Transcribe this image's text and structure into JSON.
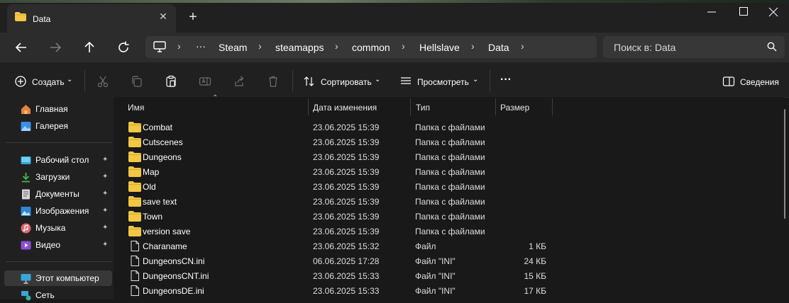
{
  "window": {
    "tab_title": "Data",
    "new_tab_glyph": "+",
    "close_tab_glyph": "✕"
  },
  "address": {
    "breadcrumbs": [
      "Steam",
      "steamapps",
      "common",
      "Hellslave",
      "Data"
    ],
    "more_glyph": "···",
    "search_placeholder": "Поиск в: Data"
  },
  "toolbar": {
    "create_label": "Создать",
    "sort_label": "Сортировать",
    "view_label": "Просмотреть",
    "more_glyph": "···",
    "details_label": "Сведения"
  },
  "sidebar": {
    "top_items": [
      {
        "label": "Главная",
        "icon": "home-icon"
      },
      {
        "label": "Галерея",
        "icon": "gallery-icon"
      }
    ],
    "pinned_items": [
      {
        "label": "Рабочий стол",
        "icon": "desktop-icon"
      },
      {
        "label": "Загрузки",
        "icon": "downloads-icon"
      },
      {
        "label": "Документы",
        "icon": "documents-icon"
      },
      {
        "label": "Изображения",
        "icon": "pictures-icon"
      },
      {
        "label": "Музыка",
        "icon": "music-icon"
      },
      {
        "label": "Видео",
        "icon": "videos-icon"
      }
    ],
    "bottom_items": [
      {
        "label": "Этот компьютер",
        "icon": "this-pc-icon"
      },
      {
        "label": "Сеть",
        "icon": "network-icon"
      }
    ]
  },
  "columns": {
    "name": "Имя",
    "date": "Дата изменения",
    "type": "Тип",
    "size": "Размер"
  },
  "files": [
    {
      "name": "Combat",
      "date": "23.06.2025 15:39",
      "type": "Папка с файлами",
      "size": "",
      "kind": "folder"
    },
    {
      "name": "Cutscenes",
      "date": "23.06.2025 15:39",
      "type": "Папка с файлами",
      "size": "",
      "kind": "folder"
    },
    {
      "name": "Dungeons",
      "date": "23.06.2025 15:39",
      "type": "Папка с файлами",
      "size": "",
      "kind": "folder"
    },
    {
      "name": "Map",
      "date": "23.06.2025 15:39",
      "type": "Папка с файлами",
      "size": "",
      "kind": "folder"
    },
    {
      "name": "Old",
      "date": "23.06.2025 15:39",
      "type": "Папка с файлами",
      "size": "",
      "kind": "folder"
    },
    {
      "name": "save text",
      "date": "23.06.2025 15:39",
      "type": "Папка с файлами",
      "size": "",
      "kind": "folder"
    },
    {
      "name": "Town",
      "date": "23.06.2025 15:39",
      "type": "Папка с файлами",
      "size": "",
      "kind": "folder"
    },
    {
      "name": "version save",
      "date": "23.06.2025 15:39",
      "type": "Папка с файлами",
      "size": "",
      "kind": "folder"
    },
    {
      "name": "Charaname",
      "date": "23.06.2025 15:32",
      "type": "Файл",
      "size": "1 КБ",
      "kind": "file"
    },
    {
      "name": "DungeonsCN.ini",
      "date": "06.06.2025 17:28",
      "type": "Файл \"INI\"",
      "size": "24 КБ",
      "kind": "file"
    },
    {
      "name": "DungeonsCNT.ini",
      "date": "23.06.2025 15:33",
      "type": "Файл \"INI\"",
      "size": "15 КБ",
      "kind": "file"
    },
    {
      "name": "DungeonsDE.ini",
      "date": "23.06.2025 15:33",
      "type": "Файл \"INI\"",
      "size": "17 КБ",
      "kind": "file"
    }
  ],
  "colors": {
    "folder": "#f2c744",
    "accent": "#4cc2ff"
  }
}
